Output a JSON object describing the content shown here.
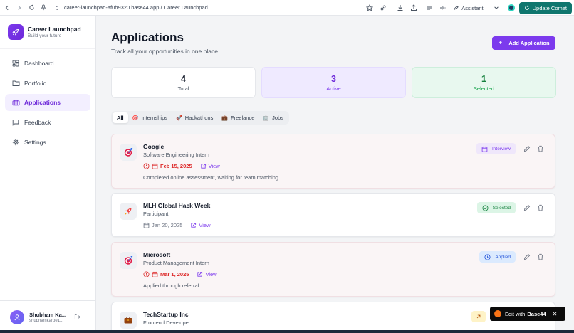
{
  "browser": {
    "url": "career-launchpad-af0b9320.base44.app / Career Launchpad",
    "assistant_label": "Assistant",
    "update_label": "Update Comet"
  },
  "sidebar": {
    "brand_title": "Career Launchpad",
    "brand_sub": "Build your future",
    "items": [
      {
        "label": "Dashboard",
        "icon": "dashboard-icon"
      },
      {
        "label": "Portfolio",
        "icon": "folder-icon"
      },
      {
        "label": "Applications",
        "icon": "briefcase-icon",
        "active": true
      },
      {
        "label": "Feedback",
        "icon": "message-icon"
      },
      {
        "label": "Settings",
        "icon": "gear-icon"
      }
    ],
    "user": {
      "name": "Shubham Ka...",
      "email": "shubhamkarpe1..."
    }
  },
  "main": {
    "title": "Applications",
    "subtitle": "Track all your opportunities in one place",
    "add_label": "Add Application",
    "stats": [
      {
        "value": "4",
        "label": "Total"
      },
      {
        "value": "3",
        "label": "Active"
      },
      {
        "value": "1",
        "label": "Selected"
      }
    ],
    "tabs": [
      {
        "label": "All",
        "icon": "",
        "active": true
      },
      {
        "label": "Internships",
        "icon": "target-icon"
      },
      {
        "label": "Hackathons",
        "icon": "rocket-icon"
      },
      {
        "label": "Freelance",
        "icon": "briefcase-icon"
      },
      {
        "label": "Jobs",
        "icon": "building-icon"
      }
    ],
    "applications": [
      {
        "company": "Google",
        "role": "Software Engineering Intern",
        "date": "Feb 15, 2025",
        "overdue": true,
        "view_label": "View",
        "note": "Completed online assessment, waiting for team matching",
        "status": "Interview",
        "icon": "target-icon"
      },
      {
        "company": "MLH Global Hack Week",
        "role": "Participant",
        "date": "Jan 20, 2025",
        "overdue": false,
        "view_label": "View",
        "note": "",
        "status": "Selected",
        "icon": "rocket-icon"
      },
      {
        "company": "Microsoft",
        "role": "Product Management Intern",
        "date": "Mar 1, 2025",
        "overdue": true,
        "view_label": "View",
        "note": "Applied through referral",
        "status": "Applied",
        "icon": "target-icon"
      },
      {
        "company": "TechStartup Inc",
        "role": "Frontend Developer",
        "status_icon": "arrow-up-right-icon",
        "icon": "briefcase-icon"
      }
    ]
  },
  "base44_badge": {
    "prefix": "Edit with",
    "brand": "Base44",
    "close": "✕"
  }
}
